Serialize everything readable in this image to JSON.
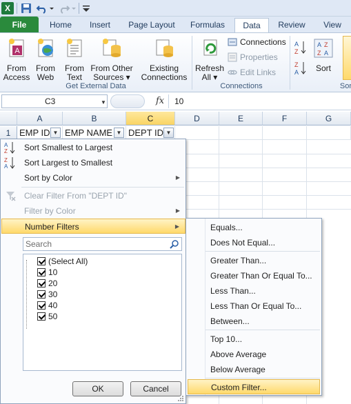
{
  "qat": {
    "excel_logo": "X"
  },
  "tabs": [
    "File",
    "Home",
    "Insert",
    "Page Layout",
    "Formulas",
    "Data",
    "Review",
    "View"
  ],
  "ribbon": {
    "get_external": {
      "from_access": [
        "From",
        "Access"
      ],
      "from_web": [
        "From",
        "Web"
      ],
      "from_text": [
        "From",
        "Text"
      ],
      "from_other": [
        "From Other",
        "Sources ▾"
      ],
      "existing": [
        "Existing",
        "Connections"
      ],
      "label": "Get External Data"
    },
    "connections": {
      "refresh": [
        "Refresh",
        "All ▾"
      ],
      "connections": "Connections",
      "properties": "Properties",
      "edit_links": "Edit Links",
      "label": "Connections"
    },
    "sort": {
      "sort_label": "Sort",
      "label_partial": "Sort"
    }
  },
  "formula_bar": {
    "name_box": "C3",
    "fx": "fx",
    "value": "10"
  },
  "columns": [
    "A",
    "B",
    "C",
    "D",
    "E",
    "F",
    "G"
  ],
  "rows": [
    "1"
  ],
  "headers": {
    "a": "EMP ID",
    "b": "EMP NAME",
    "c": "DEPT ID"
  },
  "filter_menu": {
    "sort_asc": "Sort Smallest to Largest",
    "sort_desc": "Sort Largest to Smallest",
    "sort_color": "Sort by Color",
    "clear_filter": "Clear Filter From \"DEPT ID\"",
    "filter_color": "Filter by Color",
    "number_filters": "Number Filters",
    "search_placeholder": "Search",
    "items": [
      "(Select All)",
      "10",
      "20",
      "30",
      "40",
      "50"
    ],
    "ok": "OK",
    "cancel": "Cancel"
  },
  "number_filters_submenu": {
    "equals": "Equals...",
    "not_equal": "Does Not Equal...",
    "greater": "Greater Than...",
    "greater_eq": "Greater Than Or Equal To...",
    "less": "Less Than...",
    "less_eq": "Less Than Or Equal To...",
    "between": "Between...",
    "top10": "Top 10...",
    "above_avg": "Above Average",
    "below_avg": "Below Average",
    "custom": "Custom Filter..."
  }
}
